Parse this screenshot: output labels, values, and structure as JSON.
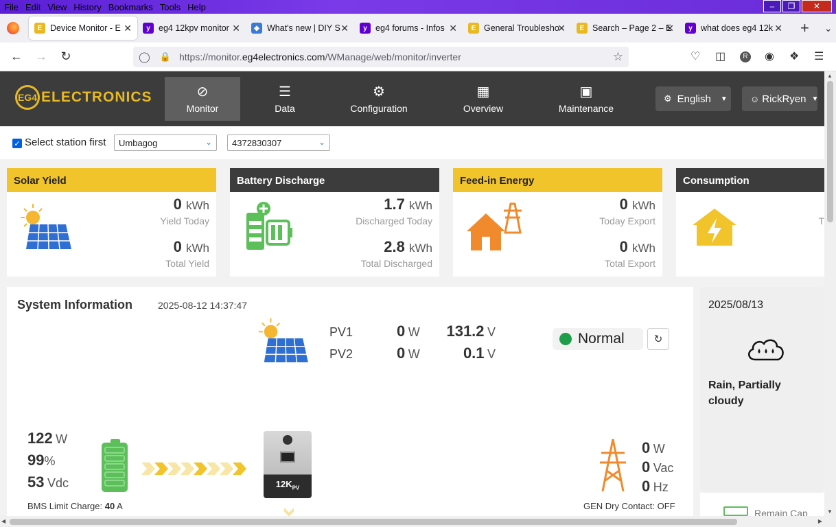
{
  "menu": [
    "File",
    "Edit",
    "View",
    "History",
    "Bookmarks",
    "Tools",
    "Help"
  ],
  "tabs": [
    {
      "title": "Device Monitor - E",
      "icon": "eg4-favicon",
      "active": true
    },
    {
      "title": "eg4 12kpv monitor",
      "icon": "yahoo-favicon"
    },
    {
      "title": "What's new | DIY S",
      "icon": "diy-favicon"
    },
    {
      "title": "eg4 forums - Infos",
      "icon": "yahoo-favicon"
    },
    {
      "title": "General Troublesho",
      "icon": "eg4-favicon"
    },
    {
      "title": "Search – Page 2 – E",
      "icon": "eg4-favicon"
    },
    {
      "title": "what does eg4 12k",
      "icon": "yahoo-favicon"
    }
  ],
  "url": {
    "prefix": "https://monitor.",
    "domain": "eg4electronics.com",
    "path": "/WManage/web/monitor/inverter"
  },
  "header": {
    "logo_text": "ELECTRONICS",
    "logo_badge": "EG4",
    "nav": [
      {
        "label": "Monitor",
        "icon": "compass-icon",
        "active": true
      },
      {
        "label": "Data",
        "icon": "database-icon"
      },
      {
        "label": "Configuration",
        "icon": "gear-icon"
      },
      {
        "label": "Overview",
        "icon": "grid-icon"
      },
      {
        "label": "Maintenance",
        "icon": "briefcase-icon"
      }
    ],
    "language": "English",
    "user": "RickRyen"
  },
  "station": {
    "checkbox_label": "Select station first",
    "station": "Umbagog",
    "device": "4372830307"
  },
  "cards": [
    {
      "title": "Solar Yield",
      "v1": "0",
      "u1": "kWh",
      "l1": "Yield Today",
      "v2": "0",
      "u2": "kWh",
      "l2": "Total Yield"
    },
    {
      "title": "Battery Discharge",
      "v1": "1.7",
      "u1": "kWh",
      "l1": "Discharged Today",
      "v2": "2.8",
      "u2": "kWh",
      "l2": "Total Discharged"
    },
    {
      "title": "Feed-in Energy",
      "v1": "0",
      "u1": "kWh",
      "l1": "Today Export",
      "v2": "0",
      "u2": "kWh",
      "l2": "Total Export"
    },
    {
      "title": "Consumption",
      "l1": "T"
    }
  ],
  "system": {
    "title": "System Information",
    "timestamp": "2025-08-12 14:37:47",
    "pv": [
      {
        "name": "PV1",
        "w": "0",
        "v": "131.2"
      },
      {
        "name": "PV2",
        "w": "0",
        "v": "0.1"
      }
    ],
    "w_unit": "W",
    "v_unit": "V",
    "status": "Normal",
    "battery": {
      "power": "122",
      "power_unit": "W",
      "soc": "99",
      "soc_unit": "%",
      "voltage": "53",
      "voltage_unit": "Vdc",
      "bms_label": "BMS Limit Charge:",
      "bms_value": "40",
      "bms_unit": "A"
    },
    "inverter_label": "12K",
    "inverter_sub": "PV",
    "grid": {
      "w": "0",
      "w_unit": "W",
      "vac": "0",
      "vac_unit": "Vac",
      "hz": "0",
      "hz_unit": "Hz",
      "gen_label": "GEN Dry Contact: OFF"
    }
  },
  "weather": {
    "date": "2025/08/13",
    "desc": "Rain, Partially cloudy",
    "remain": "Remain Cap"
  },
  "colors": {
    "accent_yellow": "#f2c42c",
    "header_dark": "#3c3c3c",
    "status_green": "#1e9e4b",
    "solar_blue": "#2f6fd3",
    "battery_green": "#5cbf5a",
    "house_orange": "#f08a2c"
  }
}
